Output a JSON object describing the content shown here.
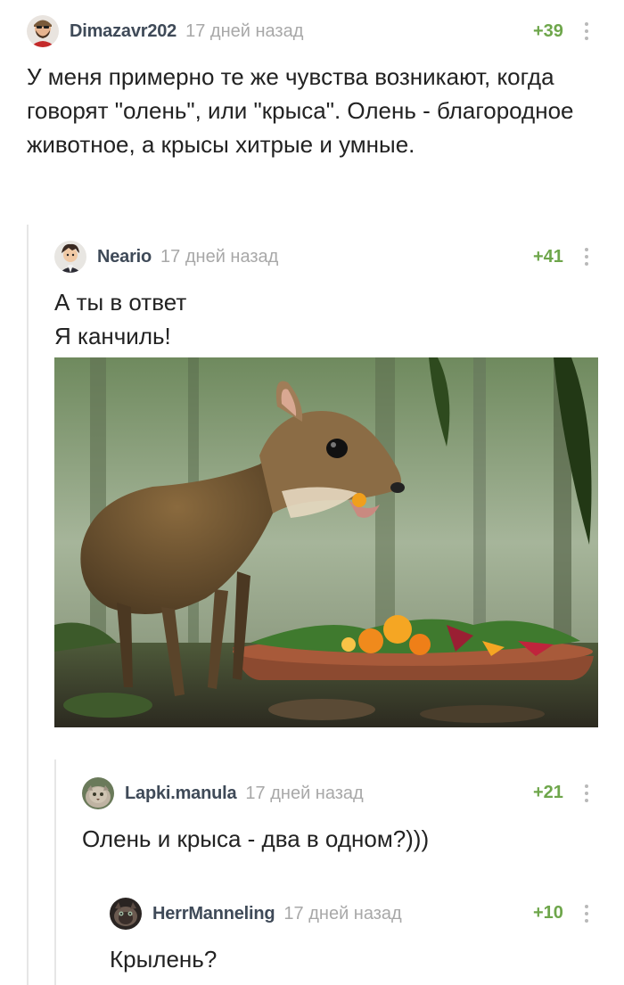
{
  "comments": [
    {
      "username": "Dimazavr202",
      "time": "17 дней назад",
      "rating": "+39",
      "text": "У меня примерно те же чувства возникают, когда говорят \"олень\", или \"крыса\". Олень - благородное животное, а крысы хитрые и умные.",
      "avatar": "avatar-bearded-man-icon"
    },
    {
      "username": "Neario",
      "time": "17 дней назад",
      "rating": "+41",
      "text": "А ты в ответ\nЯ канчиль!",
      "avatar": "avatar-anime-man-icon",
      "image": "mouse-deer-eating-photo"
    },
    {
      "username": "Lapki.manula",
      "time": "17 дней назад",
      "rating": "+21",
      "text": "Олень и крыса - два в одном?)))",
      "avatar": "avatar-manul-cat-icon"
    },
    {
      "username": "HerrManneling",
      "time": "17 дней назад",
      "rating": "+10",
      "text": "Крылень?",
      "avatar": "avatar-dark-cat-icon"
    }
  ],
  "colors": {
    "rating": "#6ea64b",
    "username": "#3f4a58",
    "time": "#a8a8a8",
    "thread_line": "#e6e6e6"
  }
}
